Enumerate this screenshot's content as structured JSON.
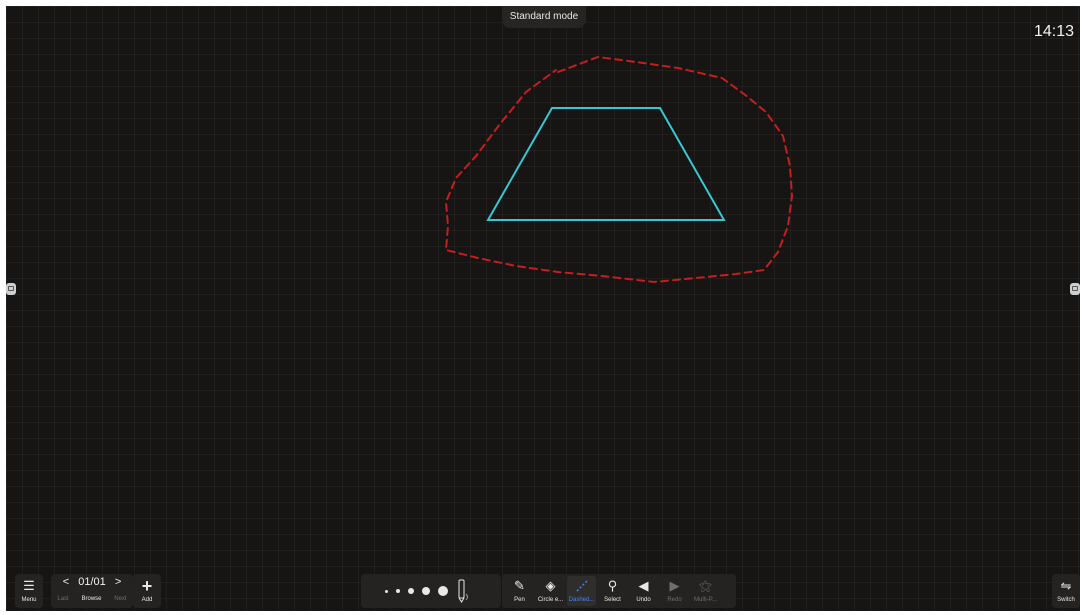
{
  "top": {
    "mode_label": "Standard mode",
    "clock": "14:13"
  },
  "colors": {
    "canvas": "#161514",
    "trapezoid": "#39c6d0",
    "dashed_loop": "#c21f1f",
    "accent": "#3f86f5"
  },
  "canvas_shapes": [
    {
      "type": "trapezoid",
      "stroke": "solid",
      "color": "#39c6d0"
    },
    {
      "type": "freehand-loop",
      "stroke": "dashed",
      "color": "#c21f1f"
    }
  ],
  "bottom_bar": {
    "menu": {
      "label": "Menu",
      "icon": "menu-icon"
    },
    "pager": {
      "current": "01/01",
      "prev_label": "Last",
      "browse_label": "Browse",
      "next_label": "Next",
      "prev_icon": "chevron-left-icon",
      "next_icon": "chevron-right-icon"
    },
    "add": {
      "label": "Add",
      "icon": "plus-icon"
    },
    "stroke_sizes": {
      "count": 5,
      "pen_preview_icon": "pen-preview-icon"
    },
    "tools": [
      {
        "label": "Pen",
        "icon": "pen-icon",
        "state": "normal"
      },
      {
        "label": "Circle e...",
        "icon": "eraser-icon",
        "state": "normal"
      },
      {
        "label": "Dashed...",
        "icon": "dashed-line-icon",
        "state": "active"
      },
      {
        "label": "Select",
        "icon": "select-icon",
        "state": "normal"
      },
      {
        "label": "Undo",
        "icon": "undo-icon",
        "state": "normal"
      },
      {
        "label": "Redo",
        "icon": "redo-icon",
        "state": "disabled"
      },
      {
        "label": "Multi-P...",
        "icon": "multi-pen-icon",
        "state": "disabled"
      }
    ],
    "switch": {
      "label": "Switch",
      "icon": "switch-icon"
    }
  }
}
